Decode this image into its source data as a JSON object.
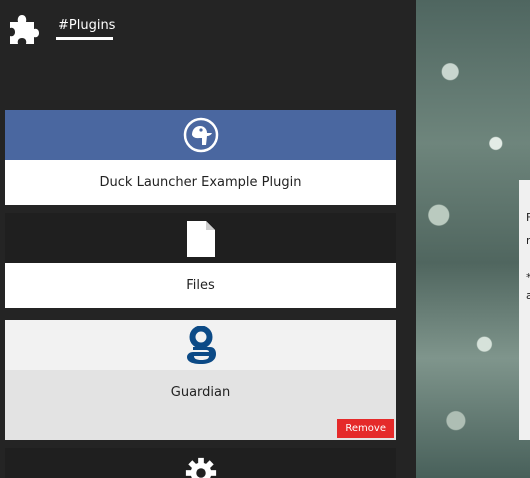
{
  "header": {
    "title": "#Plugins"
  },
  "cards": [
    {
      "name": "Duck Launcher Example Plugin",
      "color": "#4a67a0",
      "icon": "duck-icon"
    },
    {
      "name": "Files",
      "color": "#1f1f1f",
      "icon": "file-icon"
    },
    {
      "name": "Guardian",
      "color": "#f2f2f2",
      "icon": "guardian-g-icon",
      "remove_label": "Remove"
    },
    {
      "name": "",
      "color": "#1f1f1f",
      "icon": "gear-icon"
    }
  ],
  "background_window": {
    "line1": "F",
    "line2": "m",
    "line3": "*",
    "line4": "a"
  }
}
